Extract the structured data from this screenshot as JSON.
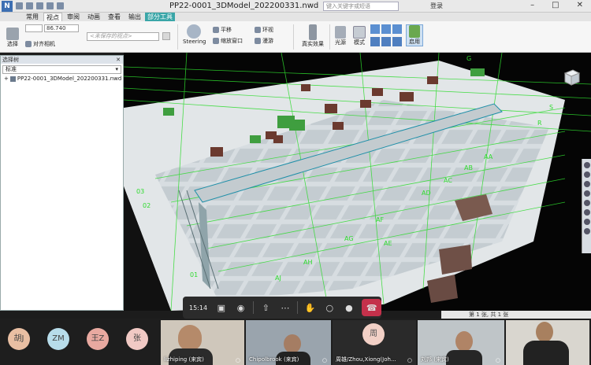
{
  "app": {
    "title": "PP22-0001_3DModel_202200331.nwd",
    "search_placeholder": "键入关键字或短语",
    "login": "登录"
  },
  "tabs": [
    {
      "label": "常用"
    },
    {
      "label": "视点"
    },
    {
      "label": "审阅"
    },
    {
      "label": "动画"
    },
    {
      "label": "查看"
    },
    {
      "label": "输出"
    },
    {
      "label": "部分工具"
    }
  ],
  "ribbon": {
    "save_label": "选择",
    "align_camera": "对齐相机",
    "value": "86.740",
    "saved_view_placeholder": "<未保存的视点>",
    "steering": "Steering",
    "pan": "平移",
    "zoom_window": "缩放窗口",
    "orbit": "环视",
    "walk": "漫游",
    "realism": "真实效果",
    "light": "光源",
    "mode": "模式",
    "enable": "启用"
  },
  "selection_panel": {
    "title": "选择树",
    "combo_value": "标准",
    "tree_item": "PP22-0001_3DModel_202200331.nwd"
  },
  "viewport": {
    "grid_labels": [
      "AE",
      "AF",
      "AG",
      "AH",
      "AJ",
      "AB",
      "AC",
      "AD",
      "03",
      "02",
      "01",
      "G",
      "H",
      "J",
      "K",
      "L",
      "M",
      "N",
      "P",
      "Q",
      "R",
      "S",
      "T",
      "U",
      "V",
      "W",
      "Y",
      "AA"
    ]
  },
  "status": {
    "page": "第 1 张, 共 1 张"
  },
  "meeting": {
    "time": "15:14",
    "participants": [
      {
        "initials": "胡J",
        "color": "#e9bfa3"
      },
      {
        "initials": "ZM",
        "color": "#b7dcea"
      },
      {
        "initials": "王Z",
        "color": "#e8a9a0"
      },
      {
        "initials": "张",
        "color": "#f0c9c4"
      },
      {
        "name": "lizhiping (来宾)"
      },
      {
        "name": "Chipolbrook (来宾)"
      },
      {
        "name": "周雄/Zhou,Xiong(Joh..."
      },
      {
        "name": "刘邦 (来宾)"
      },
      {
        "name": ""
      }
    ],
    "zhou_initial": "周"
  }
}
